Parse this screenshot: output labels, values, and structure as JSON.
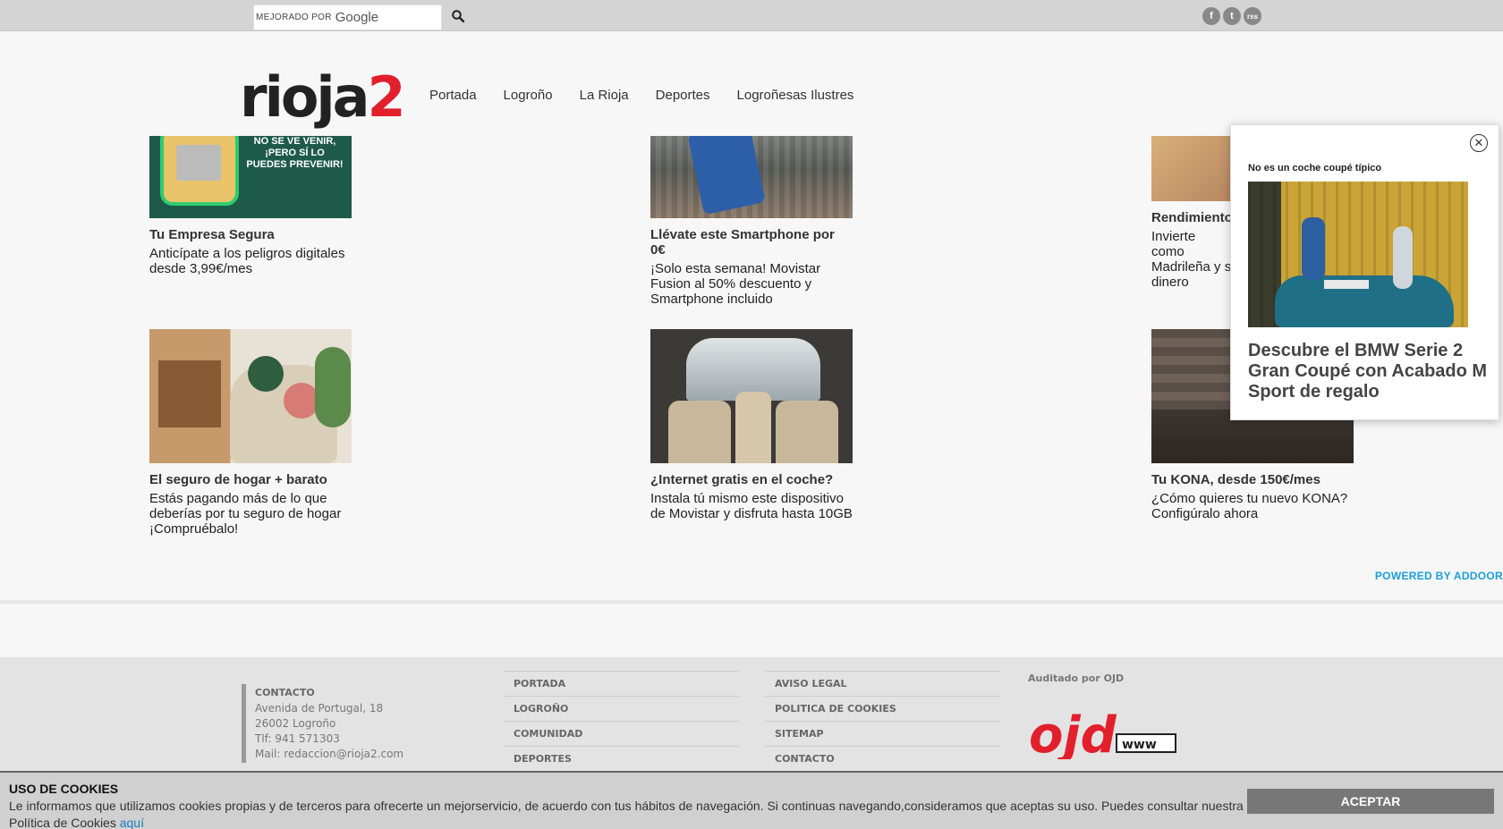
{
  "search": {
    "enhanced_by": "MEJORADO POR",
    "provider": "Google"
  },
  "social": [
    "f",
    "t",
    "rss"
  ],
  "header": {
    "logo_text": "rioja",
    "logo_num": "2",
    "nav": [
      "Portada",
      "Logroño",
      "La Rioja",
      "Deportes",
      "Logroñesas Ilustres"
    ]
  },
  "cards": [
    {
      "title": "Tu Empresa Segura",
      "desc": "Anticípate a los peligros digitales desde 3,99€/mes",
      "overlay": "NO SE VE VENIR,\n¡PERO SÍ LO\nPUEDES PREVENIR!"
    },
    {
      "title": "Llévate este Smartphone por 0€",
      "desc": "¡Solo esta semana! Movistar Fusion al 50% descuento y Smartphone incluido"
    },
    {
      "title": "Rendimiento",
      "desc": "Invierte como Madrileña y s dinero"
    },
    {
      "title": "El seguro de hogar + barato",
      "desc": "Estás pagando más de lo que deberías por tu seguro de hogar ¡Compruébalo!"
    },
    {
      "title": "¿Internet gratis en el coche?",
      "desc": "Instala tú mismo este dispositivo de Movistar y disfruta hasta 10GB"
    },
    {
      "title": "Tu KONA, desde 150€/mes",
      "desc": "¿Cómo quieres tu nuevo KONA? Configúralo ahora"
    }
  ],
  "powered_by": "POWERED BY ADDOOR",
  "popup": {
    "sponsor": "No es un coche coupé típico",
    "headline": "Descubre el BMW Serie 2 Gran Coupé con Acabado M Sport de regalo",
    "close_glyph": "✕"
  },
  "footer": {
    "contact_title": "CONTACTO",
    "contact_lines": [
      "Avenida de Portugal, 18",
      "26002 Logroño",
      "Tlf: 941 571303",
      "Mail: redaccion@rioja2.com"
    ],
    "links_col1": [
      "PORTADA",
      "LOGROÑO",
      "COMUNIDAD",
      "DEPORTES"
    ],
    "links_col2": [
      "AVISO LEGAL",
      "POLITICA DE COOKIES",
      "SITEMAP",
      "CONTACTO"
    ],
    "ojd_label": "Auditado por OJD",
    "ojd_logo_text": "ojd",
    "ojd_www": "www"
  },
  "cookies": {
    "title": "USO DE COOKIES",
    "message": "Le informamos que utilizamos cookies propias y de terceros para ofrecerte un mejorservicio, de acuerdo con tus hábitos de navegación. Si continuas navegando,consideramos que aceptas su uso. Puedes consultar nuestra Política de Cookies",
    "link": "aquí",
    "accept": "ACEPTAR"
  }
}
